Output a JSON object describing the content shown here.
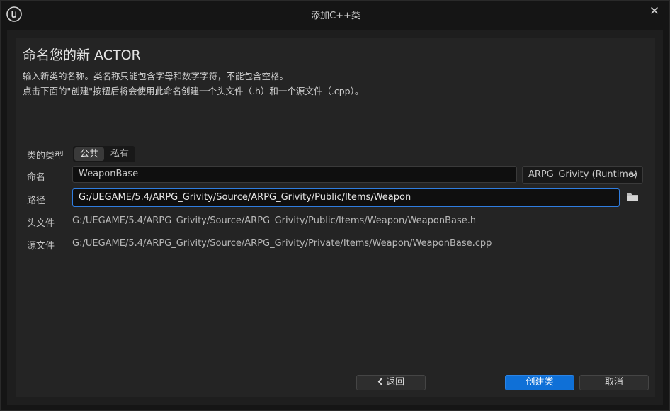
{
  "window": {
    "title": "添加C++类",
    "close_glyph": "✕"
  },
  "header": {
    "title": "命名您的新 ACTOR",
    "description_line1": "输入新类的名称。类名称只能包含字母和数字字符，不能包含空格。",
    "description_line2": "点击下面的\"创建\"按钮后将会使用此命名创建一个头文件（.h）和一个源文件（.cpp）。"
  },
  "form": {
    "class_type_label": "类的类型",
    "class_type_options": [
      "公共",
      "私有"
    ],
    "class_type_selected": "公共",
    "name_label": "命名",
    "name_value": "WeaponBase",
    "module_value": "ARPG_Grivity (Runtime)",
    "path_label": "路径",
    "path_value": "G:/UEGAME/5.4/ARPG_Grivity/Source/ARPG_Grivity/Public/Items/Weapon",
    "header_file_label": "头文件",
    "header_file_value": "G:/UEGAME/5.4/ARPG_Grivity/Source/ARPG_Grivity/Public/Items/Weapon/WeaponBase.h",
    "source_file_label": "源文件",
    "source_file_value": "G:/UEGAME/5.4/ARPG_Grivity/Source/ARPG_Grivity/Private/Items/Weapon/WeaponBase.cpp"
  },
  "buttons": {
    "back": "返回",
    "back_icon": "chevron-left-icon",
    "create": "创建类",
    "cancel": "取消"
  },
  "colors": {
    "accent": "#0f70d7",
    "focus_border": "#2f7de0",
    "background": "#151515",
    "panel": "#242424"
  },
  "icons": {
    "app_logo": "unreal-engine-logo-icon",
    "close": "close-icon",
    "module_dropdown": "chevron-down-icon",
    "browse": "folder-icon"
  }
}
